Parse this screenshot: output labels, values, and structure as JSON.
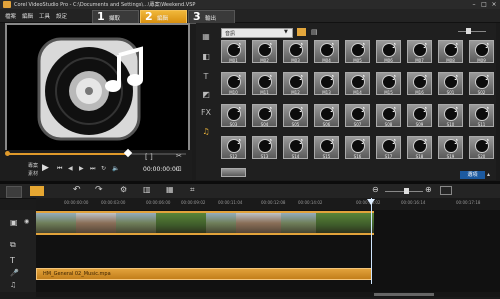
{
  "window": {
    "title": "Corel VideoStudio Pro - C:\\Documents and Settings\\...\\專案\\Weekend.VSP"
  },
  "menu": {
    "items": [
      "檔案",
      "編輯",
      "工具",
      "設定"
    ]
  },
  "steps": [
    {
      "num": "1",
      "label": "擷取"
    },
    {
      "num": "2",
      "label": "編輯"
    },
    {
      "num": "3",
      "label": "輸出"
    }
  ],
  "preview": {
    "project_label": "專案",
    "clip_label": "素材",
    "timecode": "00:00:00:00"
  },
  "library": {
    "category": "音訊",
    "tiles": [
      "M01",
      "M02",
      "M03",
      "M04",
      "M05",
      "M06",
      "M07",
      "M08",
      "M09",
      "M10",
      "M11",
      "M12",
      "M13",
      "M14",
      "M15",
      "M16",
      "S01",
      "S02",
      "S03",
      "S04",
      "S05",
      "S06",
      "S07",
      "S08",
      "S09",
      "S10",
      "S11",
      "S12",
      "S13",
      "S14",
      "S15",
      "S16",
      "S17",
      "S18",
      "S19",
      "S20"
    ],
    "options_label": "選項"
  },
  "timeline": {
    "ruler": [
      "00:00:00:00",
      "00:00:03:00",
      "00:00:06:00",
      "00:00:09:02",
      "00:00:11:04",
      "00:00:12:08",
      "00:00:14:02",
      "00:00:15:02",
      "00:00:16:14",
      "00:00:17:18"
    ],
    "audio_clip": "HM_General 02_Music.mpa"
  },
  "colors": {
    "accent": "#e8a42c",
    "background": "#1b1b1b"
  }
}
